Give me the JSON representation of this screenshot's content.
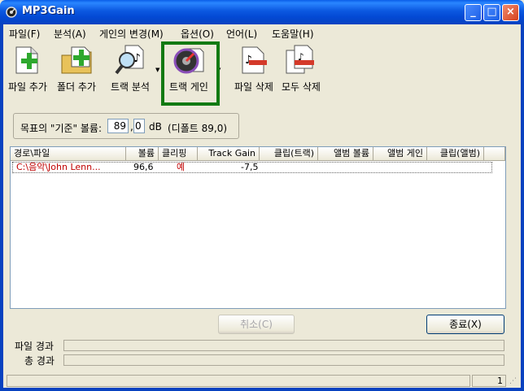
{
  "window": {
    "title": "MP3Gain"
  },
  "menu": [
    "파일(F)",
    "분석(A)",
    "게인의 변경(M)",
    "옵션(O)",
    "언어(L)",
    "도움말(H)"
  ],
  "toolbar": {
    "add_file": "파일 추가",
    "add_folder": "폴더 추가",
    "analyze_track": "트랙 분석",
    "track_gain": "트랙 게인",
    "remove_file": "파일 삭제",
    "remove_all": "모두 삭제"
  },
  "target": {
    "label": "목표의 \"기준\" 볼륨:",
    "int_value": "89",
    "dec_value": "0",
    "unit": "dB",
    "default_note": "(디폴트 89,0)"
  },
  "list": {
    "columns": [
      "경로\\파일",
      "볼륨",
      "클리핑",
      "Track Gain",
      "클립(트랙)",
      "앨범 볼륨",
      "앨범 게인",
      "클립(앨범)"
    ],
    "rows": [
      {
        "path": "C:\\음악\\John Lenn...",
        "volume": "96,6",
        "clipping": "예",
        "track_gain": "-7,5"
      }
    ]
  },
  "buttons": {
    "cancel": "취소(C)",
    "exit": "종료(X)"
  },
  "progress": {
    "file_label": "파일 경과",
    "total_label": "총 경과"
  },
  "status": {
    "count": "1"
  },
  "colors": {
    "highlight_border": "#127a12",
    "row_text": "#c00000"
  }
}
